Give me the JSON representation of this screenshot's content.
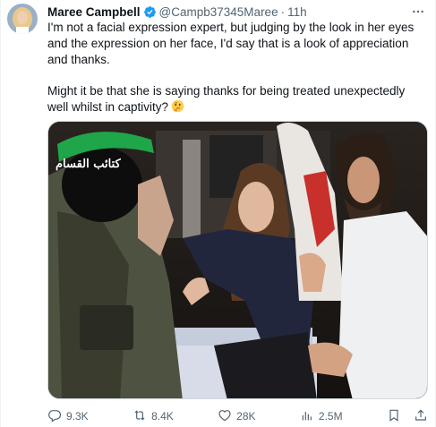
{
  "tweet": {
    "author_name": "Maree Campbell",
    "author_handle": "@Campb37345Maree",
    "separator": "·",
    "time": "11h",
    "paragraph_1": "I'm not a facial expression expert, but judging by the look in her eyes and the expression on her face, I'd say that is a look of appreciation and thanks.",
    "paragraph_2": "Might it be that she is saying thanks for being treated unexpectedly well whilst in captivity?",
    "emoji": "thinking-face",
    "media_logo_text": "كتائب القسام",
    "colors": {
      "verified": "#1d9bf0",
      "secondary_text": "#536471",
      "primary_text": "#0f1419"
    }
  },
  "actions": {
    "replies": "9.3K",
    "reposts": "8.4K",
    "likes": "28K",
    "views": "2.5M"
  }
}
